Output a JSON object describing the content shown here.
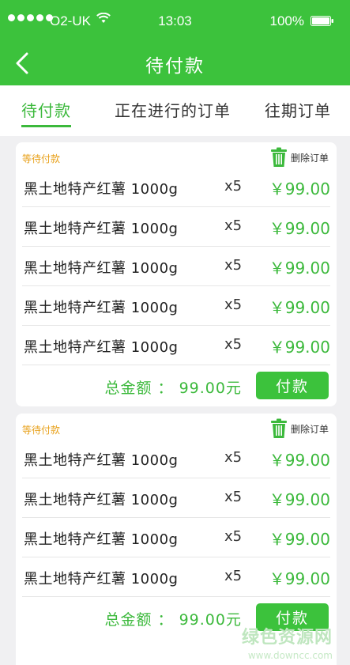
{
  "status_bar": {
    "carrier": "O2-UK",
    "time": "13:03",
    "battery": "100%"
  },
  "header": {
    "title": "待付款"
  },
  "tabs": [
    {
      "label": "待付款",
      "active": true
    },
    {
      "label": "正在进行的订单",
      "active": false
    },
    {
      "label": "往期订单",
      "active": false
    }
  ],
  "orders": [
    {
      "status": "等待付款",
      "delete_label": "删除订单",
      "items": [
        {
          "name": "黑土地特产红薯 1000g",
          "qty": "x5",
          "price": "￥99.00"
        },
        {
          "name": "黑土地特产红薯 1000g",
          "qty": "x5",
          "price": "￥99.00"
        },
        {
          "name": "黑土地特产红薯 1000g",
          "qty": "x5",
          "price": "￥99.00"
        },
        {
          "name": "黑土地特产红薯 1000g",
          "qty": "x5",
          "price": "￥99.00"
        },
        {
          "name": "黑土地特产红薯 1000g",
          "qty": "x5",
          "price": "￥99.00"
        }
      ],
      "total": "总金额 ： 99.00元",
      "pay_label": "付款"
    },
    {
      "status": "等待付款",
      "delete_label": "删除订单",
      "items": [
        {
          "name": "黑土地特产红薯 1000g",
          "qty": "x5",
          "price": "￥99.00"
        },
        {
          "name": "黑土地特产红薯 1000g",
          "qty": "x5",
          "price": "￥99.00"
        },
        {
          "name": "黑土地特产红薯 1000g",
          "qty": "x5",
          "price": "￥99.00"
        },
        {
          "name": "黑土地特产红薯 1000g",
          "qty": "x5",
          "price": "￥99.00"
        }
      ],
      "total": "总金额 ： 99.00元",
      "pay_label": "付款"
    }
  ],
  "watermark": {
    "main": "绿色资源网",
    "url": "www.downcc.com"
  },
  "colors": {
    "brand_green": "#3cc23c",
    "price_green": "#3cb93c",
    "status_orange": "#e8a11b"
  }
}
